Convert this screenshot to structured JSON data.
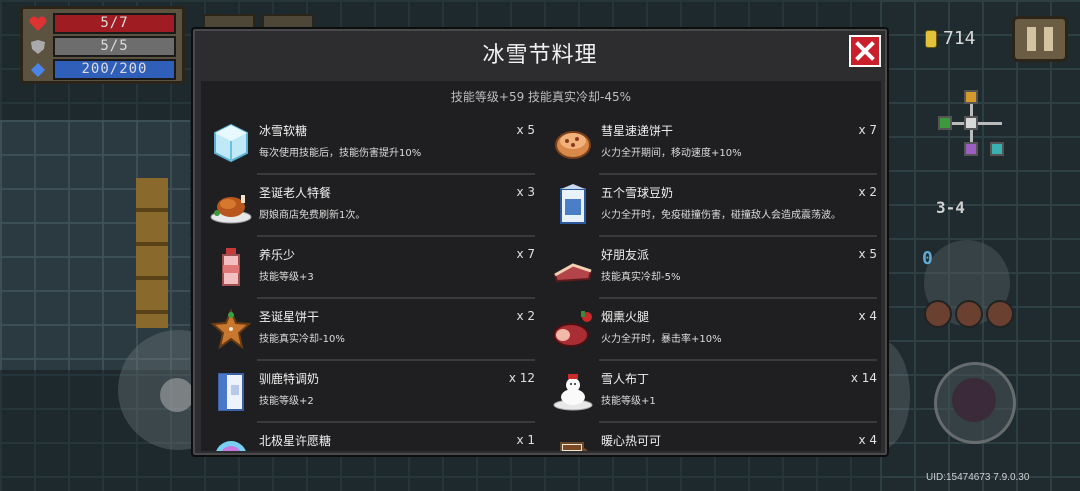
{
  "hud": {
    "hp": "5/7",
    "armor": "5/5",
    "energy": "200/200",
    "coins": "714",
    "level": "3-4",
    "ammo": "0"
  },
  "modal": {
    "title": "冰雪节料理",
    "summary": "技能等级+59 技能真实冷却-45%"
  },
  "items": [
    {
      "name": "冰雪软糖",
      "desc": "每次使用技能后，技能伤害提升10%",
      "qty": "x 5",
      "icon": "ice-cube-candy-icon"
    },
    {
      "name": "彗星速递饼干",
      "desc": "火力全开期间，移动速度+10%",
      "qty": "x 7",
      "icon": "cookie-icon"
    },
    {
      "name": "圣诞老人特餐",
      "desc": "厨娘商店免费刷新1次。",
      "qty": "x 3",
      "icon": "roast-turkey-icon"
    },
    {
      "name": "五个雪球豆奶",
      "desc": "火力全开时，免疫碰撞伤害，碰撞敌人会造成震荡波。",
      "qty": "x 2",
      "icon": "soy-milk-carton-icon"
    },
    {
      "name": "养乐少",
      "desc": "技能等级+3",
      "qty": "x 7",
      "icon": "yogurt-bottle-icon"
    },
    {
      "name": "好朋友派",
      "desc": "技能真实冷却-5%",
      "qty": "x 5",
      "icon": "pie-icon"
    },
    {
      "name": "圣诞星饼干",
      "desc": "技能真实冷却-10%",
      "qty": "x 2",
      "icon": "gingerbread-icon"
    },
    {
      "name": "烟熏火腿",
      "desc": "火力全开时，暴击率+10%",
      "qty": "x 4",
      "icon": "smoked-ham-icon"
    },
    {
      "name": "驯鹿特调奶",
      "desc": "技能等级+2",
      "qty": "x 12",
      "icon": "milk-carton-icon"
    },
    {
      "name": "雪人布丁",
      "desc": "技能等级+1",
      "qty": "x 14",
      "icon": "snowman-pudding-icon"
    },
    {
      "name": "北极星许愿糖",
      "desc": "",
      "qty": "x 1",
      "icon": "rainbow-candy-icon"
    },
    {
      "name": "暖心热可可",
      "desc": "",
      "qty": "x 4",
      "icon": "hot-cocoa-icon"
    }
  ],
  "footer": {
    "uid": "UID:15474673 7.9.0.30"
  },
  "colors": {
    "hp": "#9e1c22",
    "armor": "#6d6d6d",
    "energy": "#2f5fb8",
    "close": "#c9202b"
  }
}
